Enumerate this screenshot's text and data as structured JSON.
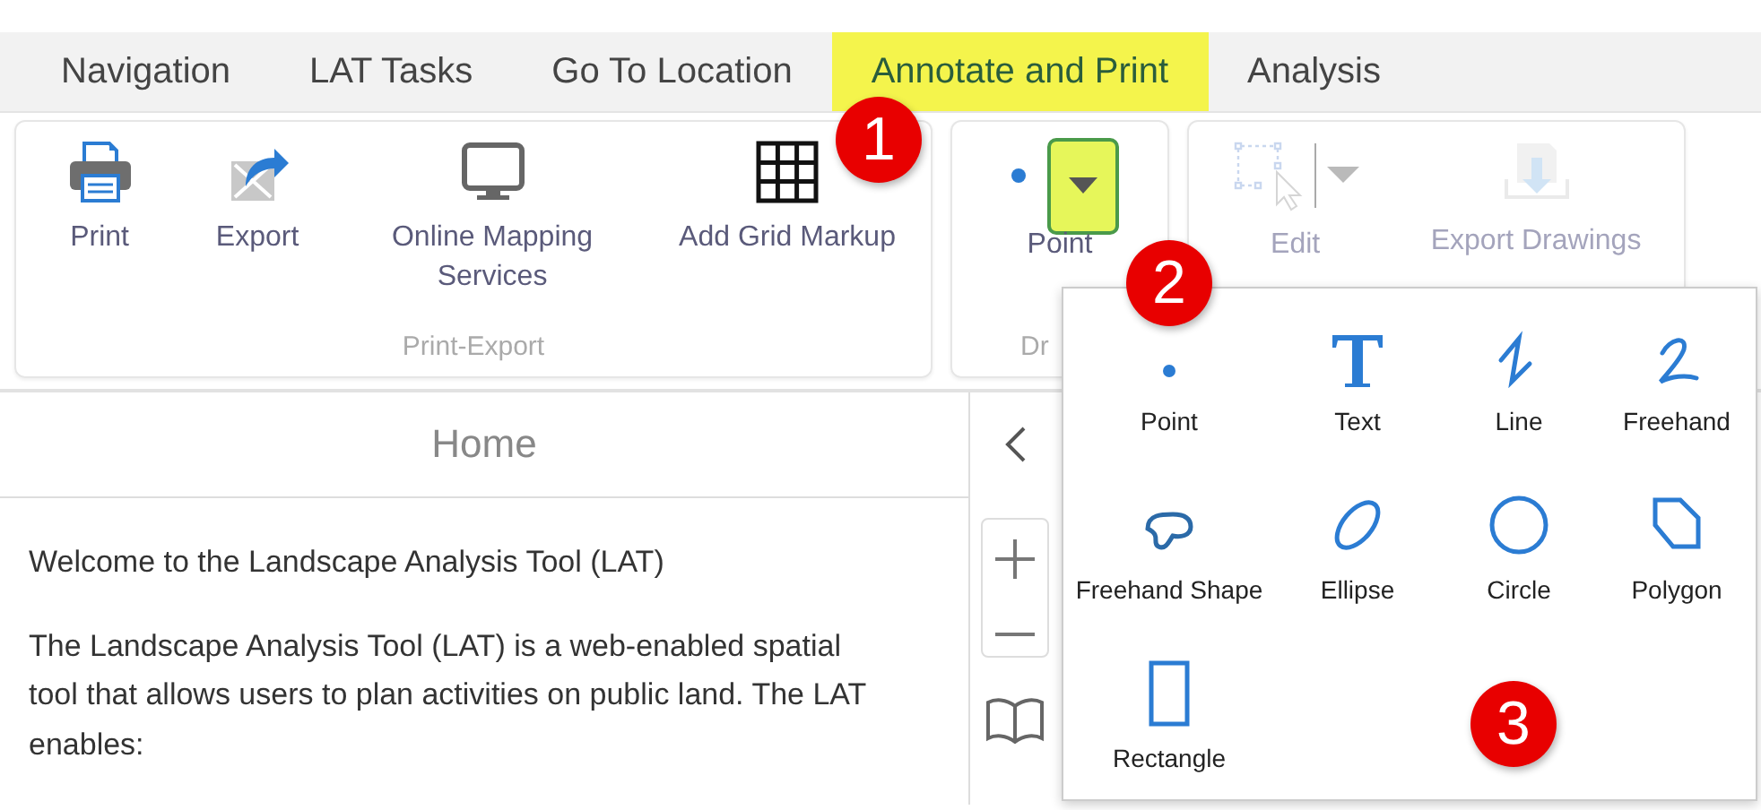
{
  "tabs": [
    {
      "label": "Navigation",
      "selected": false
    },
    {
      "label": "LAT Tasks",
      "selected": false
    },
    {
      "label": "Go To Location",
      "selected": false
    },
    {
      "label": "Annotate and Print",
      "selected": true
    },
    {
      "label": "Analysis",
      "selected": false
    }
  ],
  "ribbon": {
    "groups": [
      {
        "label": "Print-Export",
        "buttons": [
          {
            "kind": "print",
            "label": "Print",
            "disabled": false
          },
          {
            "kind": "export",
            "label": "Export",
            "disabled": false
          },
          {
            "kind": "monitor",
            "label": "Online Mapping Services",
            "disabled": false
          },
          {
            "kind": "grid",
            "label": "Add Grid Markup",
            "disabled": false
          }
        ]
      },
      {
        "label": "Dr",
        "buttons": [
          {
            "kind": "point-split",
            "label": "Point",
            "disabled": false,
            "highlighted": true
          }
        ]
      },
      {
        "buttons": [
          {
            "kind": "edit-split",
            "label": "Edit",
            "disabled": true
          },
          {
            "kind": "export-drawings",
            "label": "Export Drawings",
            "disabled": true
          }
        ]
      }
    ]
  },
  "panel": {
    "title": "Home",
    "paragraphs": [
      "Welcome to the Landscape Analysis Tool (LAT)",
      "The Landscape Analysis Tool (LAT) is a web-enabled spatial tool that allows users to plan activities on public land. The LAT enables:"
    ]
  },
  "draw_menu": {
    "items": [
      {
        "kind": "point",
        "label": "Point"
      },
      {
        "kind": "text",
        "label": "Text"
      },
      {
        "kind": "line",
        "label": "Line"
      },
      {
        "kind": "freehand",
        "label": "Freehand"
      },
      {
        "kind": "freehand-shape",
        "label": "Freehand Shape"
      },
      {
        "kind": "ellipse",
        "label": "Ellipse"
      },
      {
        "kind": "circle",
        "label": "Circle"
      },
      {
        "kind": "polygon",
        "label": "Polygon"
      },
      {
        "kind": "rectangle",
        "label": "Rectangle"
      }
    ]
  },
  "callouts": [
    "1",
    "2",
    "3"
  ]
}
